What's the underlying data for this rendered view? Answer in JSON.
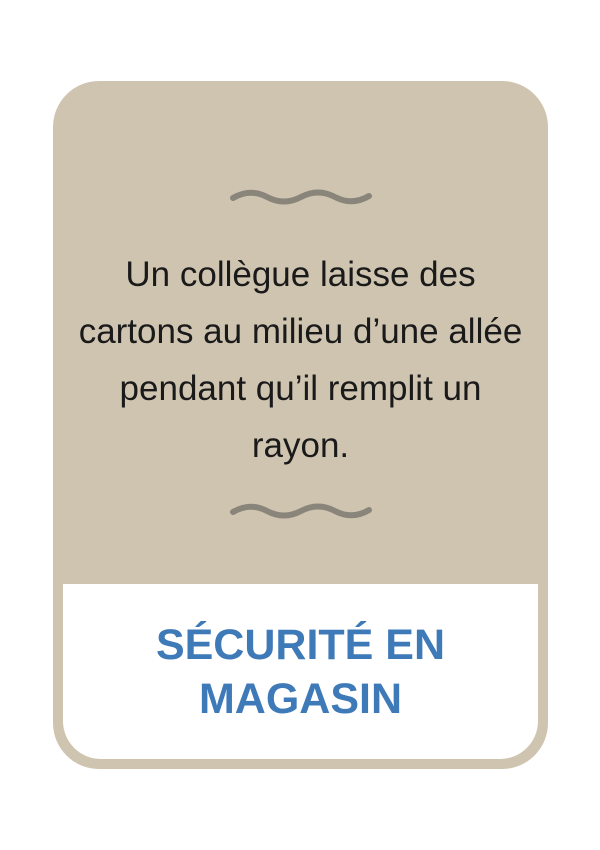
{
  "card": {
    "statement": "Un collègue laisse des cartons au milieu d’une allée pendant qu’il remplit un rayon.",
    "category": "SÉCURITÉ EN MAGASIN"
  },
  "decor": {
    "top_ornament": "wave-ornament-icon",
    "bottom_ornament": "wave-ornament-icon"
  },
  "colors": {
    "card_background": "#cfc4b0",
    "ornament": "#8a857b",
    "statement_text": "#1a1a1a",
    "category_text": "#3f7ab8",
    "label_panel": "#ffffff"
  }
}
